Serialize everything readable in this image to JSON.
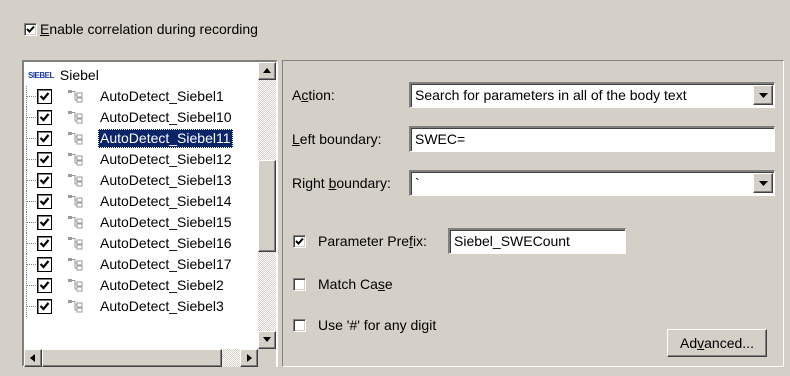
{
  "enable_correlation": {
    "checked": true,
    "label_pre": "",
    "label_accel": "E",
    "label_post": "nable correlation during recording"
  },
  "tree": {
    "root": {
      "logo_text": "SIEBEL",
      "label": "Siebel"
    },
    "items": [
      {
        "label": "AutoDetect_Siebel1",
        "checked": true,
        "selected": false
      },
      {
        "label": "AutoDetect_Siebel10",
        "checked": true,
        "selected": false
      },
      {
        "label": "AutoDetect_Siebel11",
        "checked": true,
        "selected": true
      },
      {
        "label": "AutoDetect_Siebel12",
        "checked": true,
        "selected": false
      },
      {
        "label": "AutoDetect_Siebel13",
        "checked": true,
        "selected": false
      },
      {
        "label": "AutoDetect_Siebel14",
        "checked": true,
        "selected": false
      },
      {
        "label": "AutoDetect_Siebel15",
        "checked": true,
        "selected": false
      },
      {
        "label": "AutoDetect_Siebel16",
        "checked": true,
        "selected": false
      },
      {
        "label": "AutoDetect_Siebel17",
        "checked": true,
        "selected": false
      },
      {
        "label": "AutoDetect_Siebel2",
        "checked": true,
        "selected": false
      },
      {
        "label": "AutoDetect_Siebel3",
        "checked": true,
        "selected": false
      }
    ],
    "item_icon": "rule-tree-icon",
    "scroll_up_icon": "arrow-up-icon",
    "scroll_down_icon": "arrow-down-icon",
    "scroll_left_icon": "arrow-left-icon",
    "scroll_right_icon": "arrow-right-icon"
  },
  "details": {
    "action": {
      "label_pre": "A",
      "label_accel": "c",
      "label_post": "tion:",
      "value": "Search for parameters in all of the body text"
    },
    "left_boundary": {
      "label_pre": "",
      "label_accel": "L",
      "label_post": "eft boundary:",
      "value": "SWEC="
    },
    "right_boundary": {
      "label_pre": "Right ",
      "label_accel": "b",
      "label_post": "oundary:",
      "value": "`"
    },
    "parameter_prefix": {
      "checked": true,
      "label_pre": "Parameter Pre",
      "label_accel": "f",
      "label_post": "ix:",
      "value": "Siebel_SWECount"
    },
    "match_case": {
      "checked": false,
      "label_pre": "Match Ca",
      "label_accel": "s",
      "label_post": "e"
    },
    "use_hash": {
      "checked": false,
      "label_pre": "Use '#' for any di",
      "label_accel": "g",
      "label_post": "it"
    },
    "advanced_button": {
      "label_pre": "Ad",
      "label_accel": "v",
      "label_post": "anced..."
    }
  },
  "colors": {
    "face": "#d4d0c8",
    "selection": "#0a246a",
    "logo": "#1a3aa8"
  }
}
